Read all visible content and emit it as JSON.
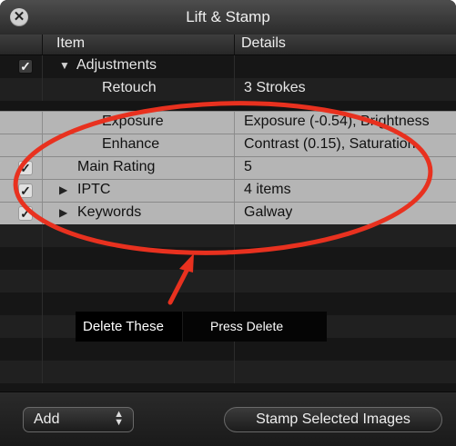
{
  "window": {
    "title": "Lift & Stamp",
    "close_glyph": "✕"
  },
  "columns": {
    "item": "Item",
    "details": "Details"
  },
  "rows": [
    {
      "item": "Adjustments",
      "details": "",
      "checked": true,
      "disclosure": "expanded",
      "selected": false
    },
    {
      "item": "Retouch",
      "details": "3 Strokes",
      "checked": null,
      "disclosure": null,
      "selected": false
    },
    {
      "item": "Exposure",
      "details": "Exposure (-0.54), Brightness",
      "checked": null,
      "disclosure": null,
      "selected": true
    },
    {
      "item": "Enhance",
      "details": "Contrast (0.15), Saturation",
      "checked": null,
      "disclosure": null,
      "selected": true
    },
    {
      "item": "Main Rating",
      "details": "5",
      "checked": true,
      "disclosure": null,
      "selected": true
    },
    {
      "item": "IPTC",
      "details": "4 items",
      "checked": true,
      "disclosure": "collapsed",
      "selected": true
    },
    {
      "item": "Keywords",
      "details": "Galway",
      "checked": true,
      "disclosure": "collapsed",
      "selected": true
    }
  ],
  "annotation": {
    "label": "Delete These",
    "hint": "Press Delete",
    "color": "#e8311f"
  },
  "bottom": {
    "add_label": "Add",
    "stamp_label": "Stamp Selected Images"
  },
  "icons": {
    "checkbox": "check-icon",
    "expanded": "disclosure-triangle-down-icon",
    "collapsed": "disclosure-triangle-right-icon",
    "popup": "up-down-arrows-icon"
  }
}
